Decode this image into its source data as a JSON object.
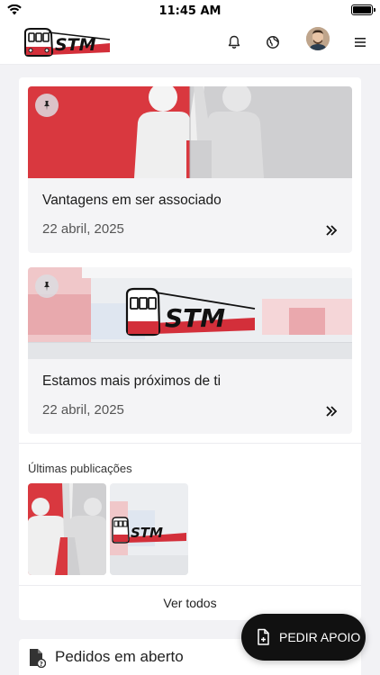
{
  "status_bar": {
    "time": "11:45 AM"
  },
  "header": {
    "logo_text": "STM",
    "icons": [
      "bell-icon",
      "globe-icon",
      "avatar",
      "menu-icon"
    ]
  },
  "posts": [
    {
      "title": "Vantagens em ser associado",
      "date": "22 abril, 2025",
      "pinned": true
    },
    {
      "title": "Estamos mais próximos de ti",
      "date": "22 abril, 2025",
      "pinned": true
    }
  ],
  "latest": {
    "title": "Últimas publicações",
    "see_all": "Ver todos"
  },
  "open_requests": {
    "title": "Pedidos em aberto"
  },
  "fab": {
    "label": "PEDIR APOIO"
  },
  "colors": {
    "brand_red": "#d32f3a",
    "dark": "#111111"
  }
}
